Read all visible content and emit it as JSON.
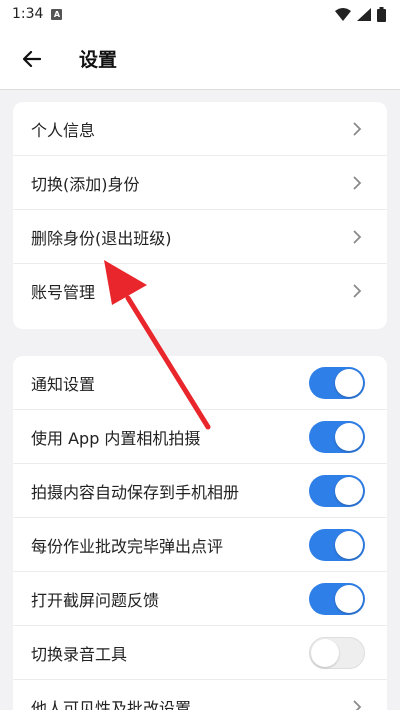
{
  "status_bar": {
    "time": "1:34",
    "notification_badge": "A",
    "icons": [
      "wifi-icon",
      "signal-icon",
      "battery-icon"
    ]
  },
  "header": {
    "title": "设置",
    "back_icon": "arrow-left-icon"
  },
  "account_section": {
    "items": [
      {
        "label": "个人信息"
      },
      {
        "label": "切换(添加)身份"
      },
      {
        "label": "删除身份(退出班级)"
      },
      {
        "label": "账号管理"
      }
    ]
  },
  "settings_section": {
    "items": [
      {
        "label": "通知设置",
        "enabled": true
      },
      {
        "label": "使用 App 内置相机拍摄",
        "enabled": true
      },
      {
        "label": "拍摄内容自动保存到手机相册",
        "enabled": true
      },
      {
        "label": "每份作业批改完毕弹出点评",
        "enabled": true
      },
      {
        "label": "打开截屏问题反馈",
        "enabled": true
      },
      {
        "label": "切换录音工具",
        "enabled": false
      },
      {
        "label": "他人可见性及批改设置"
      }
    ]
  },
  "colors": {
    "accent": "#2f7fe8",
    "annotation_arrow": "#e8262c",
    "background": "#f2f2f4"
  }
}
